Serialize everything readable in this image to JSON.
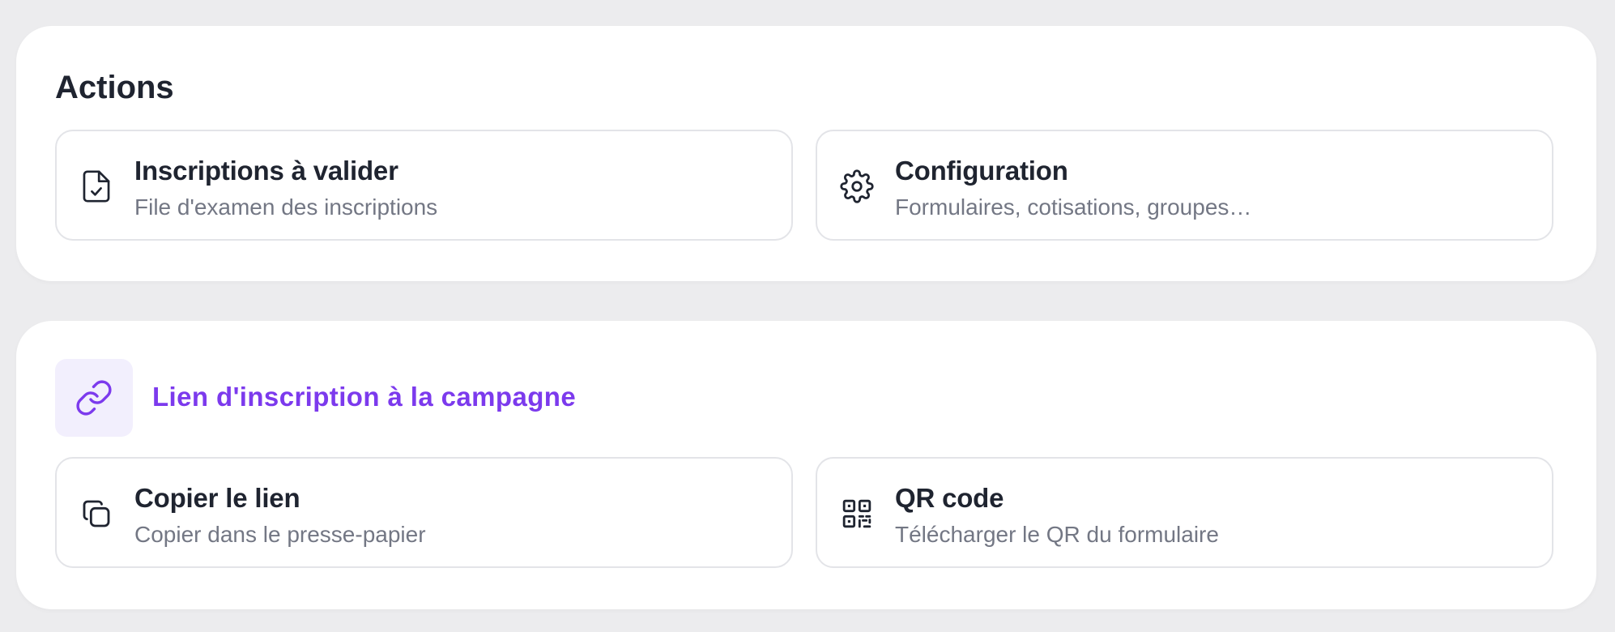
{
  "colors": {
    "page_background": "#ececee",
    "panel_background": "#ffffff",
    "accent": "#7c3aed",
    "accent_soft": "#f2effd",
    "text_primary": "#1f2430",
    "text_secondary": "#737784",
    "card_border": "#e3e4e8"
  },
  "actions": {
    "title": "Actions",
    "cards": [
      {
        "icon": "file-check-icon",
        "title": "Inscriptions à valider",
        "subtitle": "File d'examen des inscriptions"
      },
      {
        "icon": "gear-icon",
        "title": "Configuration",
        "subtitle": "Formulaires, cotisations, groupes…"
      }
    ]
  },
  "campaign_link": {
    "icon": "link-icon",
    "title": "Lien d'inscription à la campagne",
    "cards": [
      {
        "icon": "copy-icon",
        "title": "Copier le lien",
        "subtitle": "Copier dans le presse-papier"
      },
      {
        "icon": "qr-code-icon",
        "title": "QR code",
        "subtitle": "Télécharger le QR du formulaire"
      }
    ]
  }
}
